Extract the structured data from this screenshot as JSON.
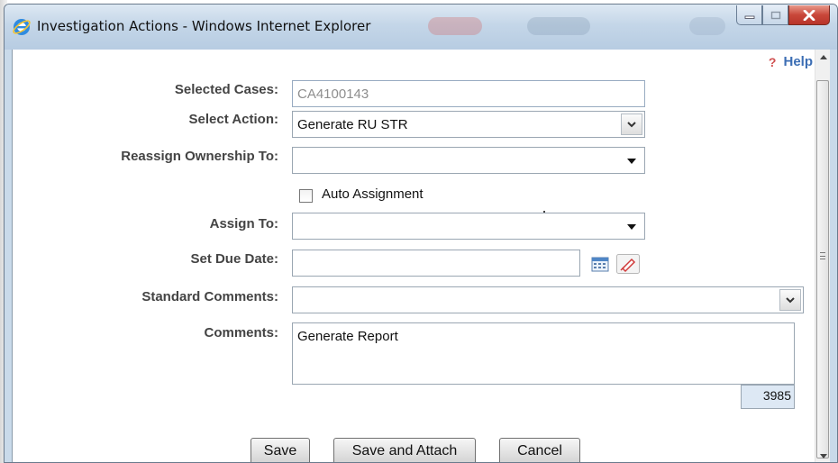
{
  "window": {
    "title": "Investigation Actions - Windows Internet Explorer"
  },
  "help": {
    "label": "Help"
  },
  "form": {
    "selected_cases": {
      "label": "Selected Cases:",
      "value": "CA4100143"
    },
    "select_action": {
      "label": "Select Action:",
      "value": "Generate RU STR"
    },
    "reassign_ownership": {
      "label": "Reassign Ownership To:",
      "value": ""
    },
    "auto_assignment": {
      "label": "Auto Assignment",
      "checked": false
    },
    "assign_to": {
      "label": "Assign To:",
      "value": ""
    },
    "due_date": {
      "label": "Set Due Date:",
      "value": ""
    },
    "standard_comments": {
      "label": "Standard Comments:",
      "value": ""
    },
    "comments": {
      "label": "Comments:",
      "value": "Generate Report",
      "remaining_chars": "3985"
    }
  },
  "buttons": {
    "save": "Save",
    "save_attach": "Save and Attach",
    "cancel": "Cancel"
  },
  "colors": {
    "titlebar": "#c4d6e8",
    "close_button": "#c9473a",
    "label_text": "#444444",
    "help_link": "#3c6eb4",
    "counter_bg": "#dde8f4"
  }
}
